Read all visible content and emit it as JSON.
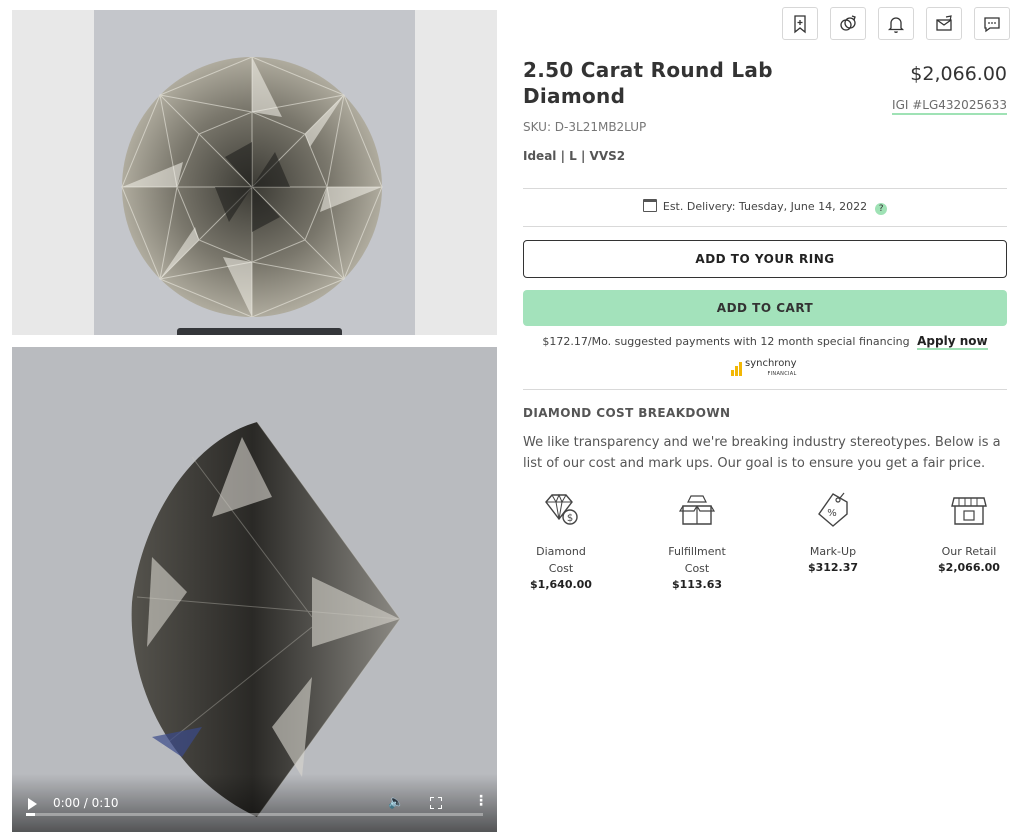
{
  "toolbar": {
    "icons": [
      "bookmark-icon",
      "ring-link-icon",
      "bell-icon",
      "email-icon",
      "chat-icon"
    ]
  },
  "product": {
    "title": "2.50 Carat Round Lab Diamond",
    "price": "$2,066.00",
    "igi": "IGI #LG432025633",
    "sku": "SKU: D-3L21MB2LUP",
    "specs": "Ideal | L | VVS2"
  },
  "delivery": {
    "text": "Est. Delivery: Tuesday, June 14, 2022",
    "help": "?"
  },
  "actions": {
    "add_to_ring": "ADD TO YOUR RING",
    "add_to_cart": "ADD TO CART"
  },
  "financing": {
    "text": "$172.17/Mo. suggested payments with 12 month special financing",
    "apply": "Apply now",
    "brand": "synchrony",
    "brand_sub": "FINANCIAL"
  },
  "breakdown": {
    "title": "DIAMOND COST BREAKDOWN",
    "description": "We like transparency and we're breaking industry stereotypes. Below is a list of our cost and mark ups. Our goal is to ensure you get a fair price.",
    "items": [
      {
        "label": "Diamond Cost",
        "value": "$1,640.00",
        "icon": "diamond-dollar-icon"
      },
      {
        "label": "Fulfillment Cost",
        "value": "$113.63",
        "icon": "box-icon"
      },
      {
        "label": "Mark-Up",
        "value": "$312.37",
        "icon": "price-tag-icon"
      },
      {
        "label": "Our Retail",
        "value": "$2,066.00",
        "icon": "storefront-icon"
      }
    ]
  },
  "video": {
    "time": "0:00 / 0:10",
    "progress": 0.02
  }
}
